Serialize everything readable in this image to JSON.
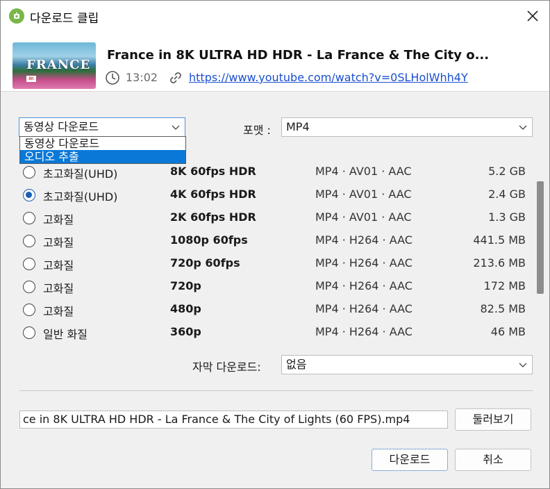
{
  "window": {
    "title": "다운로드 클립"
  },
  "video": {
    "title": "France in 8K ULTRA HD HDR - La France & The City o...",
    "thumbnail_text": "FRANCE",
    "thumbnail_badge": "8K",
    "duration": "13:02",
    "url": "https://www.youtube.com/watch?v=0SLHolWhh4Y"
  },
  "mode": {
    "selected": "동영상 다운로드",
    "options": [
      "동영상 다운로드",
      "오디오 추출"
    ],
    "highlighted_option": "오디오 추출"
  },
  "format": {
    "label": "포맷 :",
    "selected": "MP4"
  },
  "streams": [
    {
      "quality": "초고화질(UHD)",
      "resolution": "8K 60fps HDR",
      "codec": "MP4 · AV01 · AAC",
      "size": "5.2 GB",
      "checked": false
    },
    {
      "quality": "초고화질(UHD)",
      "resolution": "4K 60fps HDR",
      "codec": "MP4 · AV01 · AAC",
      "size": "2.4 GB",
      "checked": true
    },
    {
      "quality": "고화질",
      "resolution": "2K 60fps HDR",
      "codec": "MP4 · AV01 · AAC",
      "size": "1.3 GB",
      "checked": false
    },
    {
      "quality": "고화질",
      "resolution": "1080p 60fps",
      "codec": "MP4 · H264 · AAC",
      "size": "441.5 MB",
      "checked": false
    },
    {
      "quality": "고화질",
      "resolution": "720p 60fps",
      "codec": "MP4 · H264 · AAC",
      "size": "213.6 MB",
      "checked": false
    },
    {
      "quality": "고화질",
      "resolution": "720p",
      "codec": "MP4 · H264 · AAC",
      "size": "172 MB",
      "checked": false
    },
    {
      "quality": "고화질",
      "resolution": "480p",
      "codec": "MP4 · H264 · AAC",
      "size": "82.5 MB",
      "checked": false
    },
    {
      "quality": "일반 화질",
      "resolution": "360p",
      "codec": "MP4 · H264 · AAC",
      "size": "46 MB",
      "checked": false
    }
  ],
  "subtitle": {
    "label": "자막 다운로드:",
    "selected": "없음"
  },
  "output": {
    "filename": "ce in 8K ULTRA HD HDR - La France & The City of Lights (60 FPS).mp4",
    "browse_label": "둘러보기"
  },
  "actions": {
    "download_label": "다운로드",
    "cancel_label": "취소"
  },
  "colors": {
    "accent": "#0a78d7",
    "link": "#1a4fcf",
    "app_icon": "#7ab648"
  }
}
